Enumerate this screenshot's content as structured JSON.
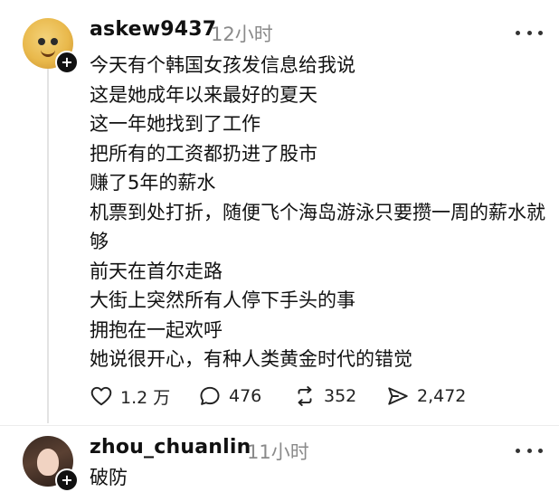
{
  "post": {
    "username": "askew9437",
    "timestamp": "12小时",
    "lines": [
      "今天有个韩国女孩发信息给我说",
      "这是她成年以来最好的夏天",
      "这一年她找到了工作",
      "把所有的工资都扔进了股市",
      "赚了5年的薪水",
      "机票到处打折，随便飞个海岛游泳只要攒一周的薪水就够",
      "前天在首尔走路",
      "大街上突然所有人停下手头的事",
      "拥抱在一起欢呼",
      "她说很开心，有种人类黄金时代的错觉"
    ],
    "stats": {
      "likes": "1.2 万",
      "replies": "476",
      "reposts": "352",
      "shares": "2,472"
    }
  },
  "reply": {
    "username": "zhou_chuanlin",
    "timestamp": "11小时",
    "text": "破防"
  },
  "icons": {
    "like": "heart-icon",
    "reply": "comment-bubble-icon",
    "repost": "repost-arrows-icon",
    "share": "send-paper-plane-icon",
    "more": "more-dots-icon",
    "follow": "plus-icon"
  }
}
